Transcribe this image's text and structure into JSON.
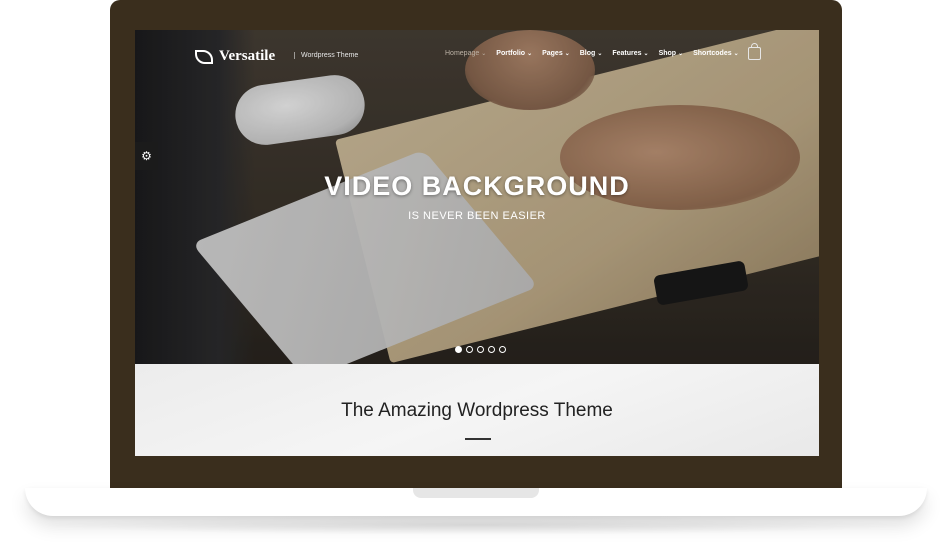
{
  "site": {
    "logo_text": "Versatile",
    "tagline": "Wordpress Theme"
  },
  "nav": {
    "items": [
      {
        "label": "Homepage",
        "active": true
      },
      {
        "label": "Portfolio",
        "active": false
      },
      {
        "label": "Pages",
        "active": false
      },
      {
        "label": "Blog",
        "active": false
      },
      {
        "label": "Features",
        "active": false
      },
      {
        "label": "Shop",
        "active": false
      },
      {
        "label": "Shortcodes",
        "active": false
      }
    ]
  },
  "hero": {
    "title": "VIDEO BACKGROUND",
    "subtitle": "IS NEVER BEEN EASIER",
    "slide_count": 5,
    "active_slide": 1
  },
  "intro": {
    "title": "The Amazing Wordpress Theme"
  },
  "colors": {
    "laptop_frame": "#3a2e1d",
    "accent_text": "#ffffff"
  },
  "icons": {
    "logo": "leaf-icon",
    "cart": "shopping-bag-icon",
    "settings": "gears-icon",
    "dropdown": "chevron-down-icon"
  }
}
